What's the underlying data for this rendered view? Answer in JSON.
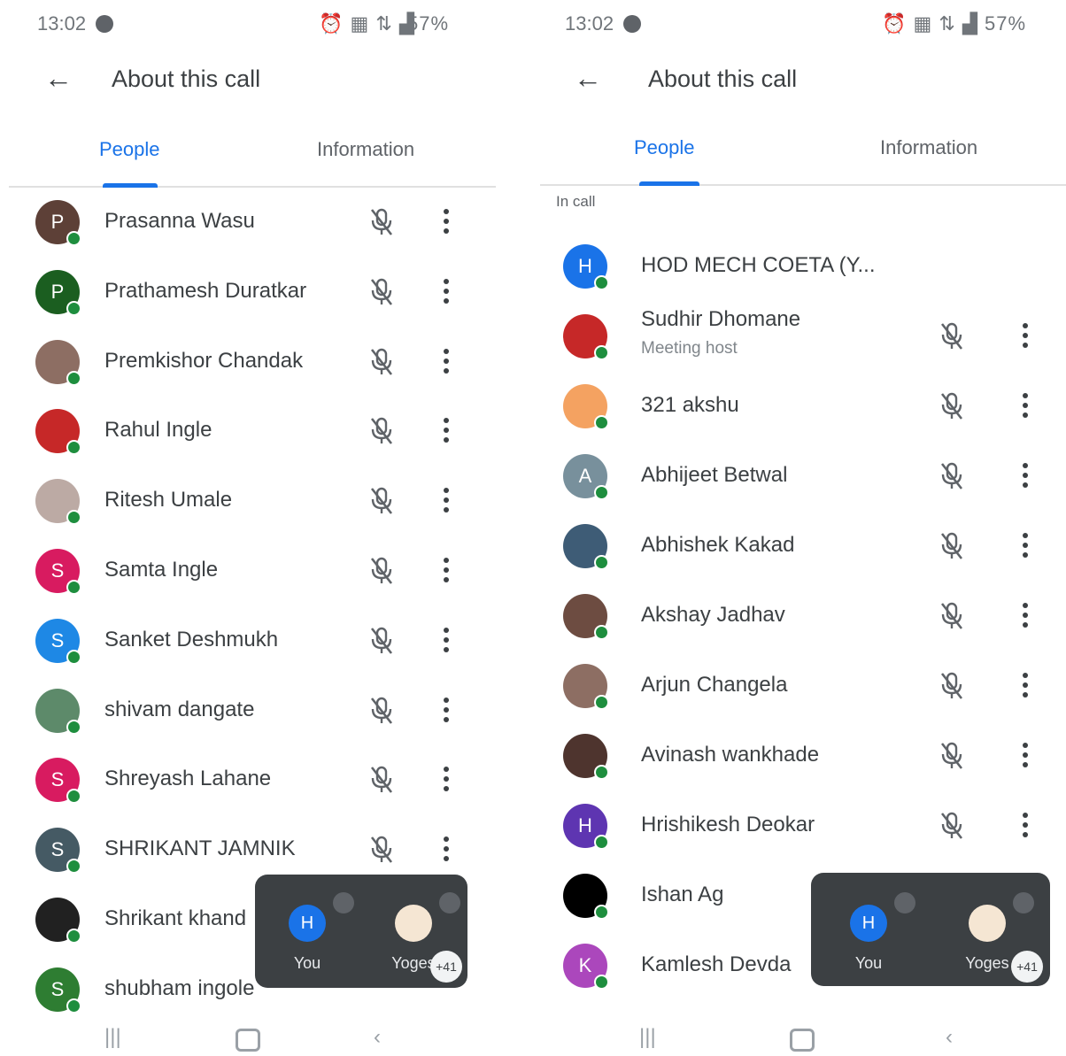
{
  "left_screen": {
    "status": {
      "time": "13:02",
      "battery": "57%"
    },
    "title": "About this call",
    "tabs": [
      "People",
      "Information"
    ],
    "participants": [
      {
        "name": "Prasanna Wasu",
        "initial": "P",
        "color": "#5d4037"
      },
      {
        "name": "Prathamesh Duratkar",
        "initial": "P",
        "color": "#1b5e20"
      },
      {
        "name": "Premkishor Chandak",
        "initial": "",
        "color": "#8d6e63"
      },
      {
        "name": "Rahul Ingle",
        "initial": "",
        "color": "#c62828"
      },
      {
        "name": "Ritesh Umale",
        "initial": "",
        "color": "#bcaaa4"
      },
      {
        "name": "Samta Ingle",
        "initial": "S",
        "color": "#d81b60"
      },
      {
        "name": "Sanket Deshmukh",
        "initial": "S",
        "color": "#1e88e5"
      },
      {
        "name": "shivam dangate",
        "initial": "",
        "color": "#5d8a6a"
      },
      {
        "name": "Shreyash Lahane",
        "initial": "S",
        "color": "#d81b60"
      },
      {
        "name": "SHRIKANT JAMNIK",
        "initial": "S",
        "color": "#455a64"
      },
      {
        "name": "Shrikant khand",
        "initial": "",
        "color": "#212121"
      },
      {
        "name": "shubham ingole",
        "initial": "S",
        "color": "#2e7d32"
      }
    ],
    "pip": {
      "you_initial": "H",
      "you_label": "You",
      "other_label": "Yoges",
      "count": "+41"
    }
  },
  "right_screen": {
    "status": {
      "time": "13:02",
      "battery": "57%"
    },
    "title": "About this call",
    "tabs": [
      "People",
      "Information"
    ],
    "section_label": "In call",
    "participants": [
      {
        "name": "HOD MECH COETA (Y...",
        "initial": "H",
        "color": "#1a73e8",
        "sub": "",
        "controls": false
      },
      {
        "name": "Sudhir Dhomane",
        "initial": "",
        "color": "#c62828",
        "sub": "Meeting host",
        "controls": true
      },
      {
        "name": "321 akshu",
        "initial": "",
        "color": "#f4a261",
        "sub": "",
        "controls": true
      },
      {
        "name": "Abhijeet Betwal",
        "initial": "A",
        "color": "#78909c",
        "sub": "",
        "controls": true
      },
      {
        "name": "Abhishek Kakad",
        "initial": "",
        "color": "#3e5c76",
        "sub": "",
        "controls": true
      },
      {
        "name": "Akshay Jadhav",
        "initial": "",
        "color": "#6d4c41",
        "sub": "",
        "controls": true
      },
      {
        "name": "Arjun Changela",
        "initial": "",
        "color": "#8d6e63",
        "sub": "",
        "controls": true
      },
      {
        "name": "Avinash wankhade",
        "initial": "",
        "color": "#4e342e",
        "sub": "",
        "controls": true
      },
      {
        "name": "Hrishikesh Deokar",
        "initial": "H",
        "color": "#5e35b1",
        "sub": "",
        "controls": true
      },
      {
        "name": "Ishan Ag",
        "initial": "",
        "color": "#000000",
        "sub": "",
        "controls": false
      },
      {
        "name": "Kamlesh Devda",
        "initial": "K",
        "color": "#ab47bc",
        "sub": "",
        "controls": false
      }
    ],
    "pip": {
      "you_initial": "H",
      "you_label": "You",
      "other_label": "Yoges",
      "count": "+41"
    }
  }
}
